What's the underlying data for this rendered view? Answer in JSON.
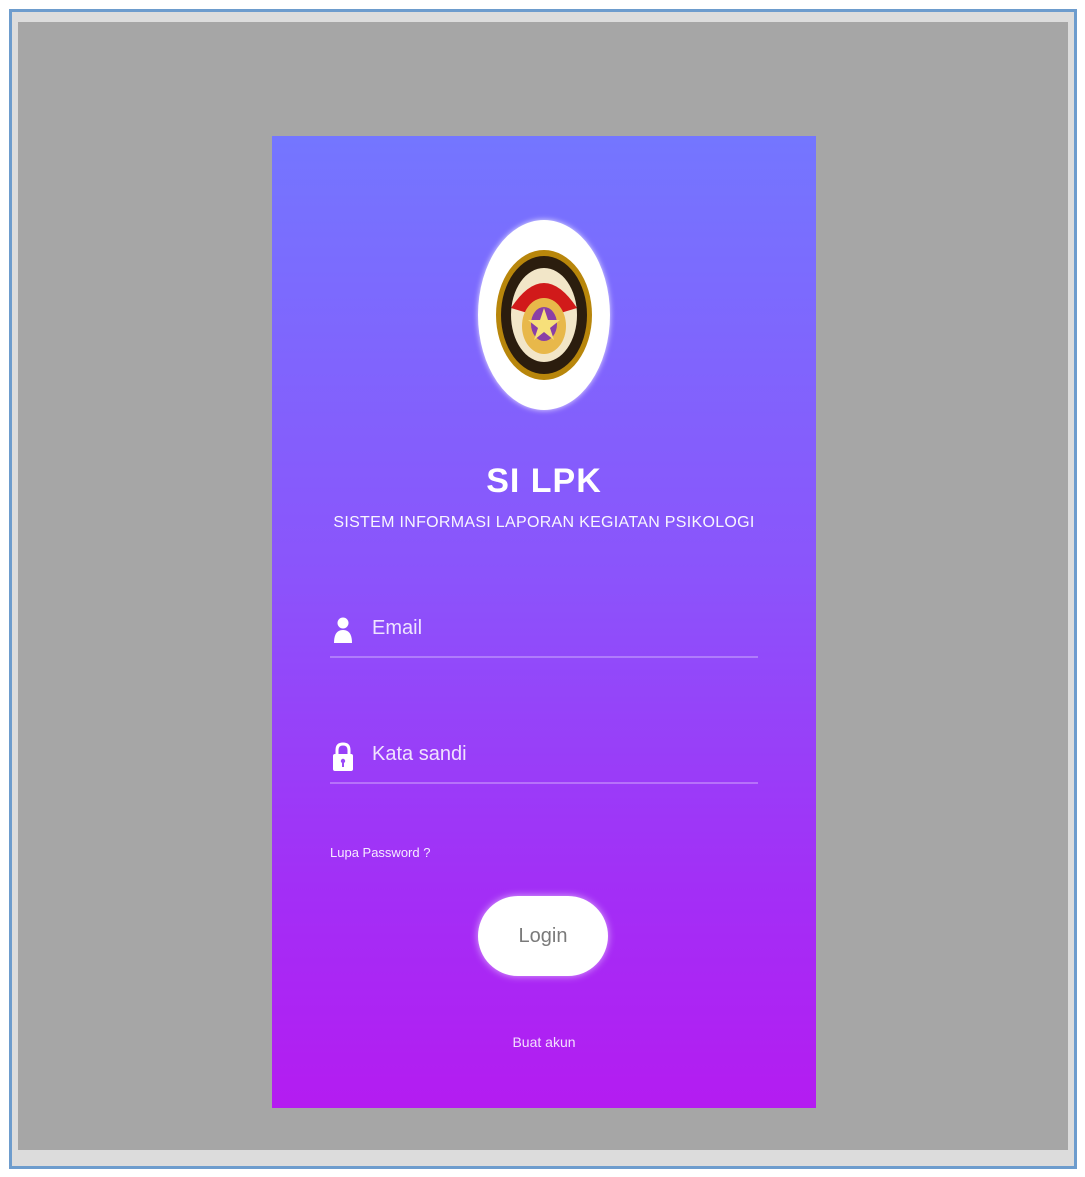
{
  "login": {
    "app_title": "SI LPK",
    "app_subtitle": "SISTEM INFORMASI LAPORAN KEGIATAN PSIKOLOGI",
    "email_placeholder": "Email",
    "password_placeholder": "Kata sandi",
    "forgot_password": "Lupa Password ?",
    "login_button": "Login",
    "signup_link": "Buat akun"
  },
  "icons": {
    "logo": "emblem-logo",
    "email": "user-icon",
    "password": "lock-icon"
  },
  "colors": {
    "gradient_top": "#7476ff",
    "gradient_bottom": "#b41cf1",
    "backdrop": "#a6a6a6",
    "frame_border": "#6d9ccd"
  }
}
